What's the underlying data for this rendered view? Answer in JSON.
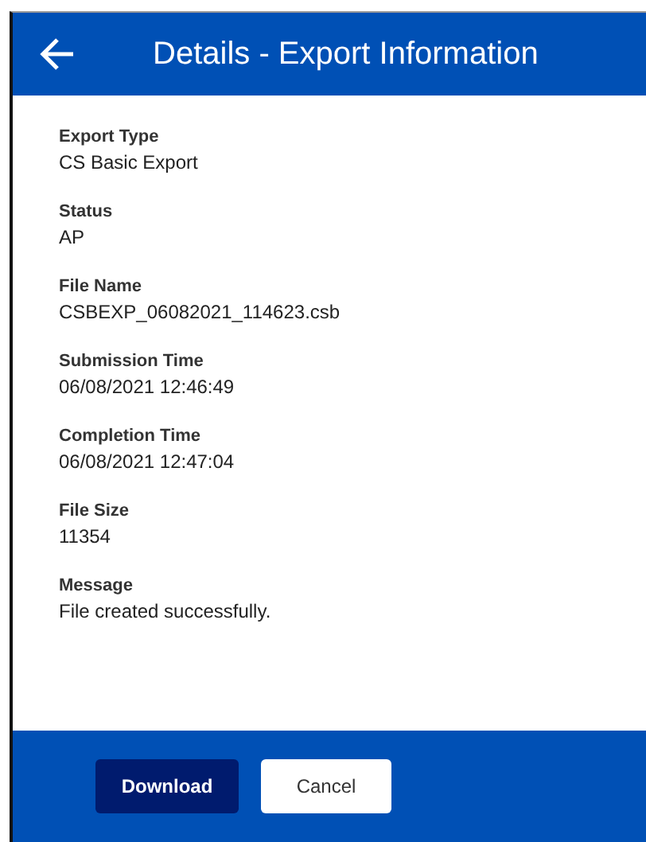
{
  "header": {
    "title": "Details - Export Information"
  },
  "fields": [
    {
      "label": "Export Type",
      "value": "CS Basic Export"
    },
    {
      "label": "Status",
      "value": "AP"
    },
    {
      "label": "File Name",
      "value": "CSBEXP_06082021_114623.csb"
    },
    {
      "label": "Submission Time",
      "value": "06/08/2021 12:46:49"
    },
    {
      "label": "Completion Time",
      "value": "06/08/2021 12:47:04"
    },
    {
      "label": "File Size",
      "value": "11354"
    },
    {
      "label": "Message",
      "value": "File created successfully."
    }
  ],
  "buttons": [
    {
      "label": "Download",
      "kind": "primary"
    },
    {
      "label": "Cancel",
      "kind": "secondary"
    }
  ]
}
